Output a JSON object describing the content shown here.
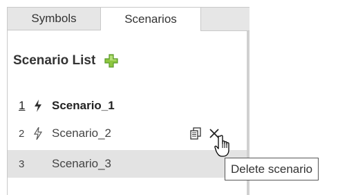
{
  "tabs": {
    "symbols_label": "Symbols",
    "scenarios_label": "Scenarios"
  },
  "scenario_list": {
    "title": "Scenario List",
    "add_icon": "green-plus-icon"
  },
  "scenarios": [
    {
      "number": "1",
      "name": "Scenario_1",
      "bolt_icon": "lightning-bolt-icon",
      "active": true
    },
    {
      "number": "2",
      "name": "Scenario_2",
      "bolt_icon": "lightning-bolt-icon",
      "hovered": true,
      "actions": [
        "copy-icon",
        "close-icon"
      ]
    },
    {
      "number": "3",
      "name": "Scenario_3",
      "selected": true
    }
  ],
  "tooltip": {
    "text": "Delete scenario"
  },
  "colors": {
    "add_icon": "#7ac143",
    "selected_row": "#e3e3e3",
    "inactive_tab": "#e6e6e6"
  }
}
